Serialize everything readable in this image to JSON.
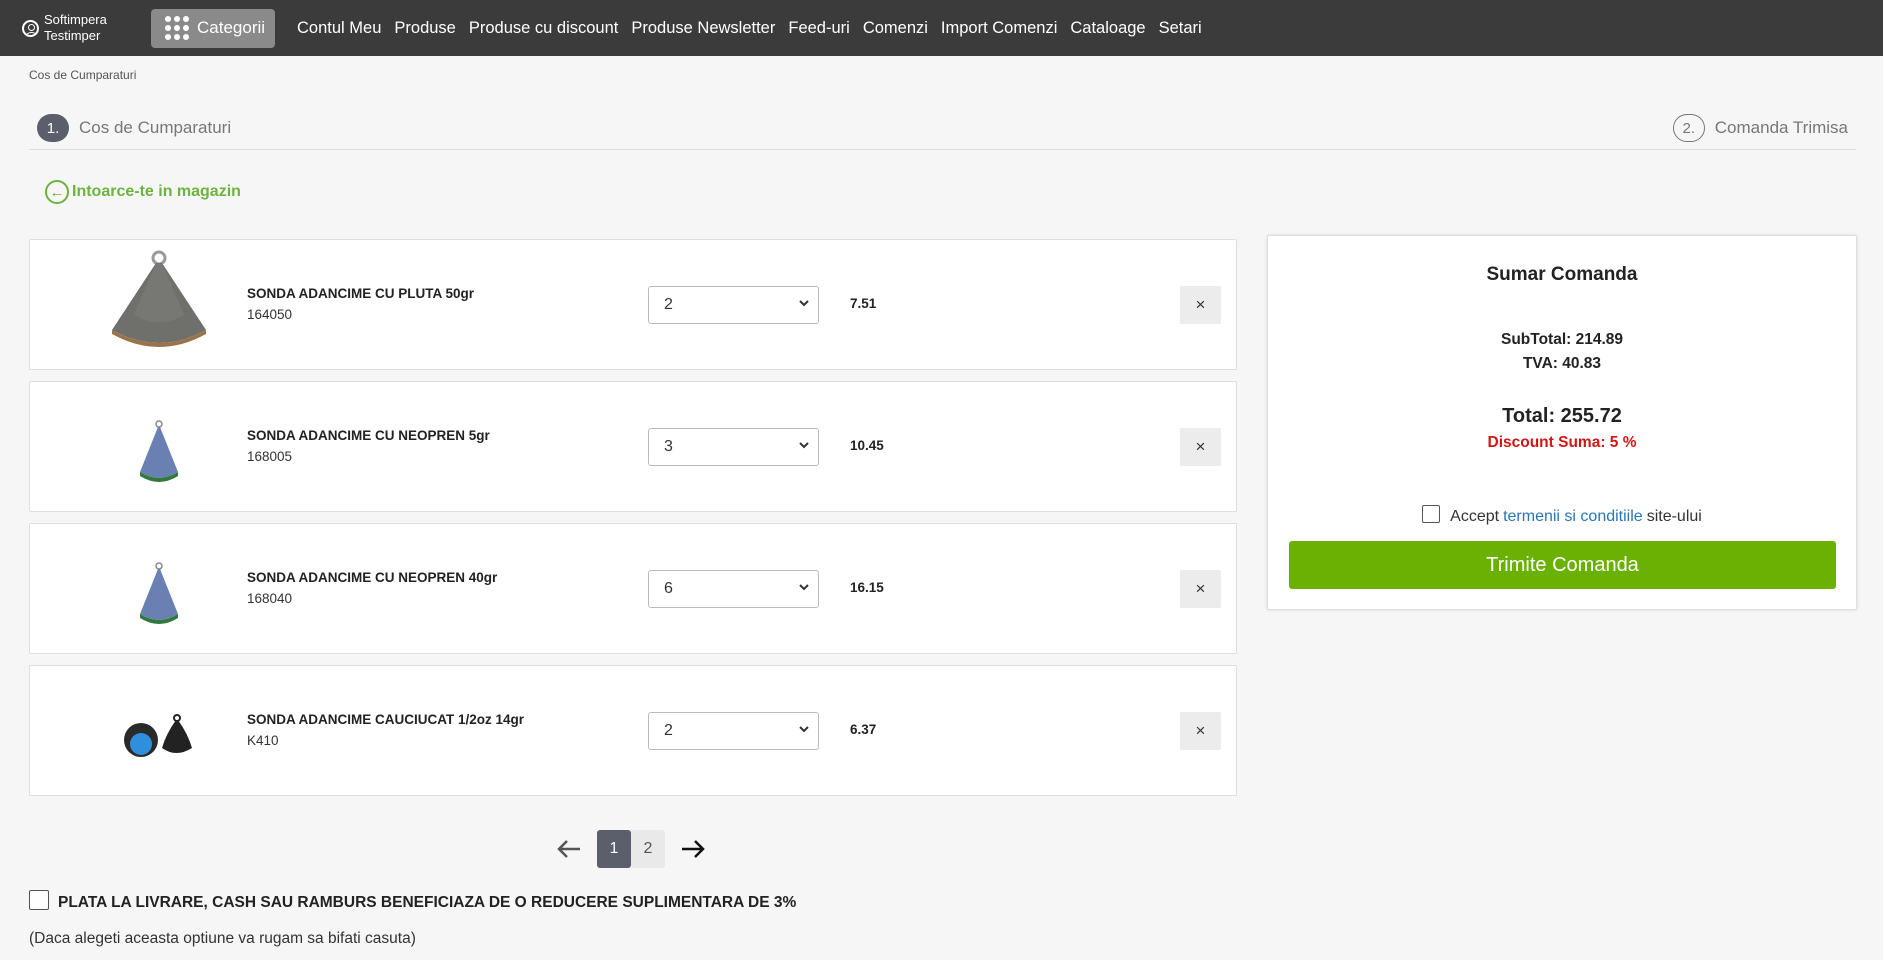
{
  "nav": {
    "account_name_line1": "Softimpera",
    "account_name_line2": "Testimper",
    "categories_label": "Categorii",
    "menu": [
      "Contul Meu",
      "Produse",
      "Produse cu discount",
      "Produse Newsletter",
      "Feed-uri",
      "Comenzi",
      "Import Comenzi",
      "Cataloage",
      "Setari"
    ]
  },
  "breadcrumb": "Cos de Cumparaturi",
  "steps": [
    {
      "num": "1.",
      "label": "Cos de Cumparaturi"
    },
    {
      "num": "2.",
      "label": "Comanda Trimisa"
    }
  ],
  "back_link": "Intoarce-te in magazin",
  "cart_items": [
    {
      "name": "SONDA ADANCIME CU PLUTA 50gr",
      "code": "164050",
      "qty": "2",
      "price": "7.51"
    },
    {
      "name": "SONDA ADANCIME CU NEOPREN 5gr",
      "code": "168005",
      "qty": "3",
      "price": "10.45"
    },
    {
      "name": "SONDA ADANCIME CU NEOPREN 40gr",
      "code": "168040",
      "qty": "6",
      "price": "16.15"
    },
    {
      "name": "SONDA ADANCIME CAUCIUCAT 1/2oz 14gr",
      "code": "K410",
      "qty": "2",
      "price": "6.37"
    }
  ],
  "remove_label": "×",
  "pagination": {
    "active": "1",
    "other": "2"
  },
  "summary": {
    "title": "Sumar Comanda",
    "subtotal": "SubTotal: 214.89",
    "tva": "TVA: 40.83",
    "total": "Total: 255.72",
    "discount": "Discount Suma: 5 %",
    "terms_pre": "Accept",
    "terms_link": "termenii si conditiile",
    "terms_post": "site-ului",
    "submit": "Trimite Comanda"
  },
  "cash_option": "PLATA LA LIVRARE, CASH SAU RAMBURS BENEFICIAZA DE O REDUCERE SUPLIMENTARA DE 3%",
  "cash_note": "(Daca alegeti aceasta optiune va rugam sa bifati casuta)",
  "colors": {
    "nav_bg": "#3b3b3b",
    "accent_green": "#6ab103",
    "link_green": "#6cb33f",
    "discount_red": "#d01717",
    "link_blue": "#2a74b8"
  }
}
